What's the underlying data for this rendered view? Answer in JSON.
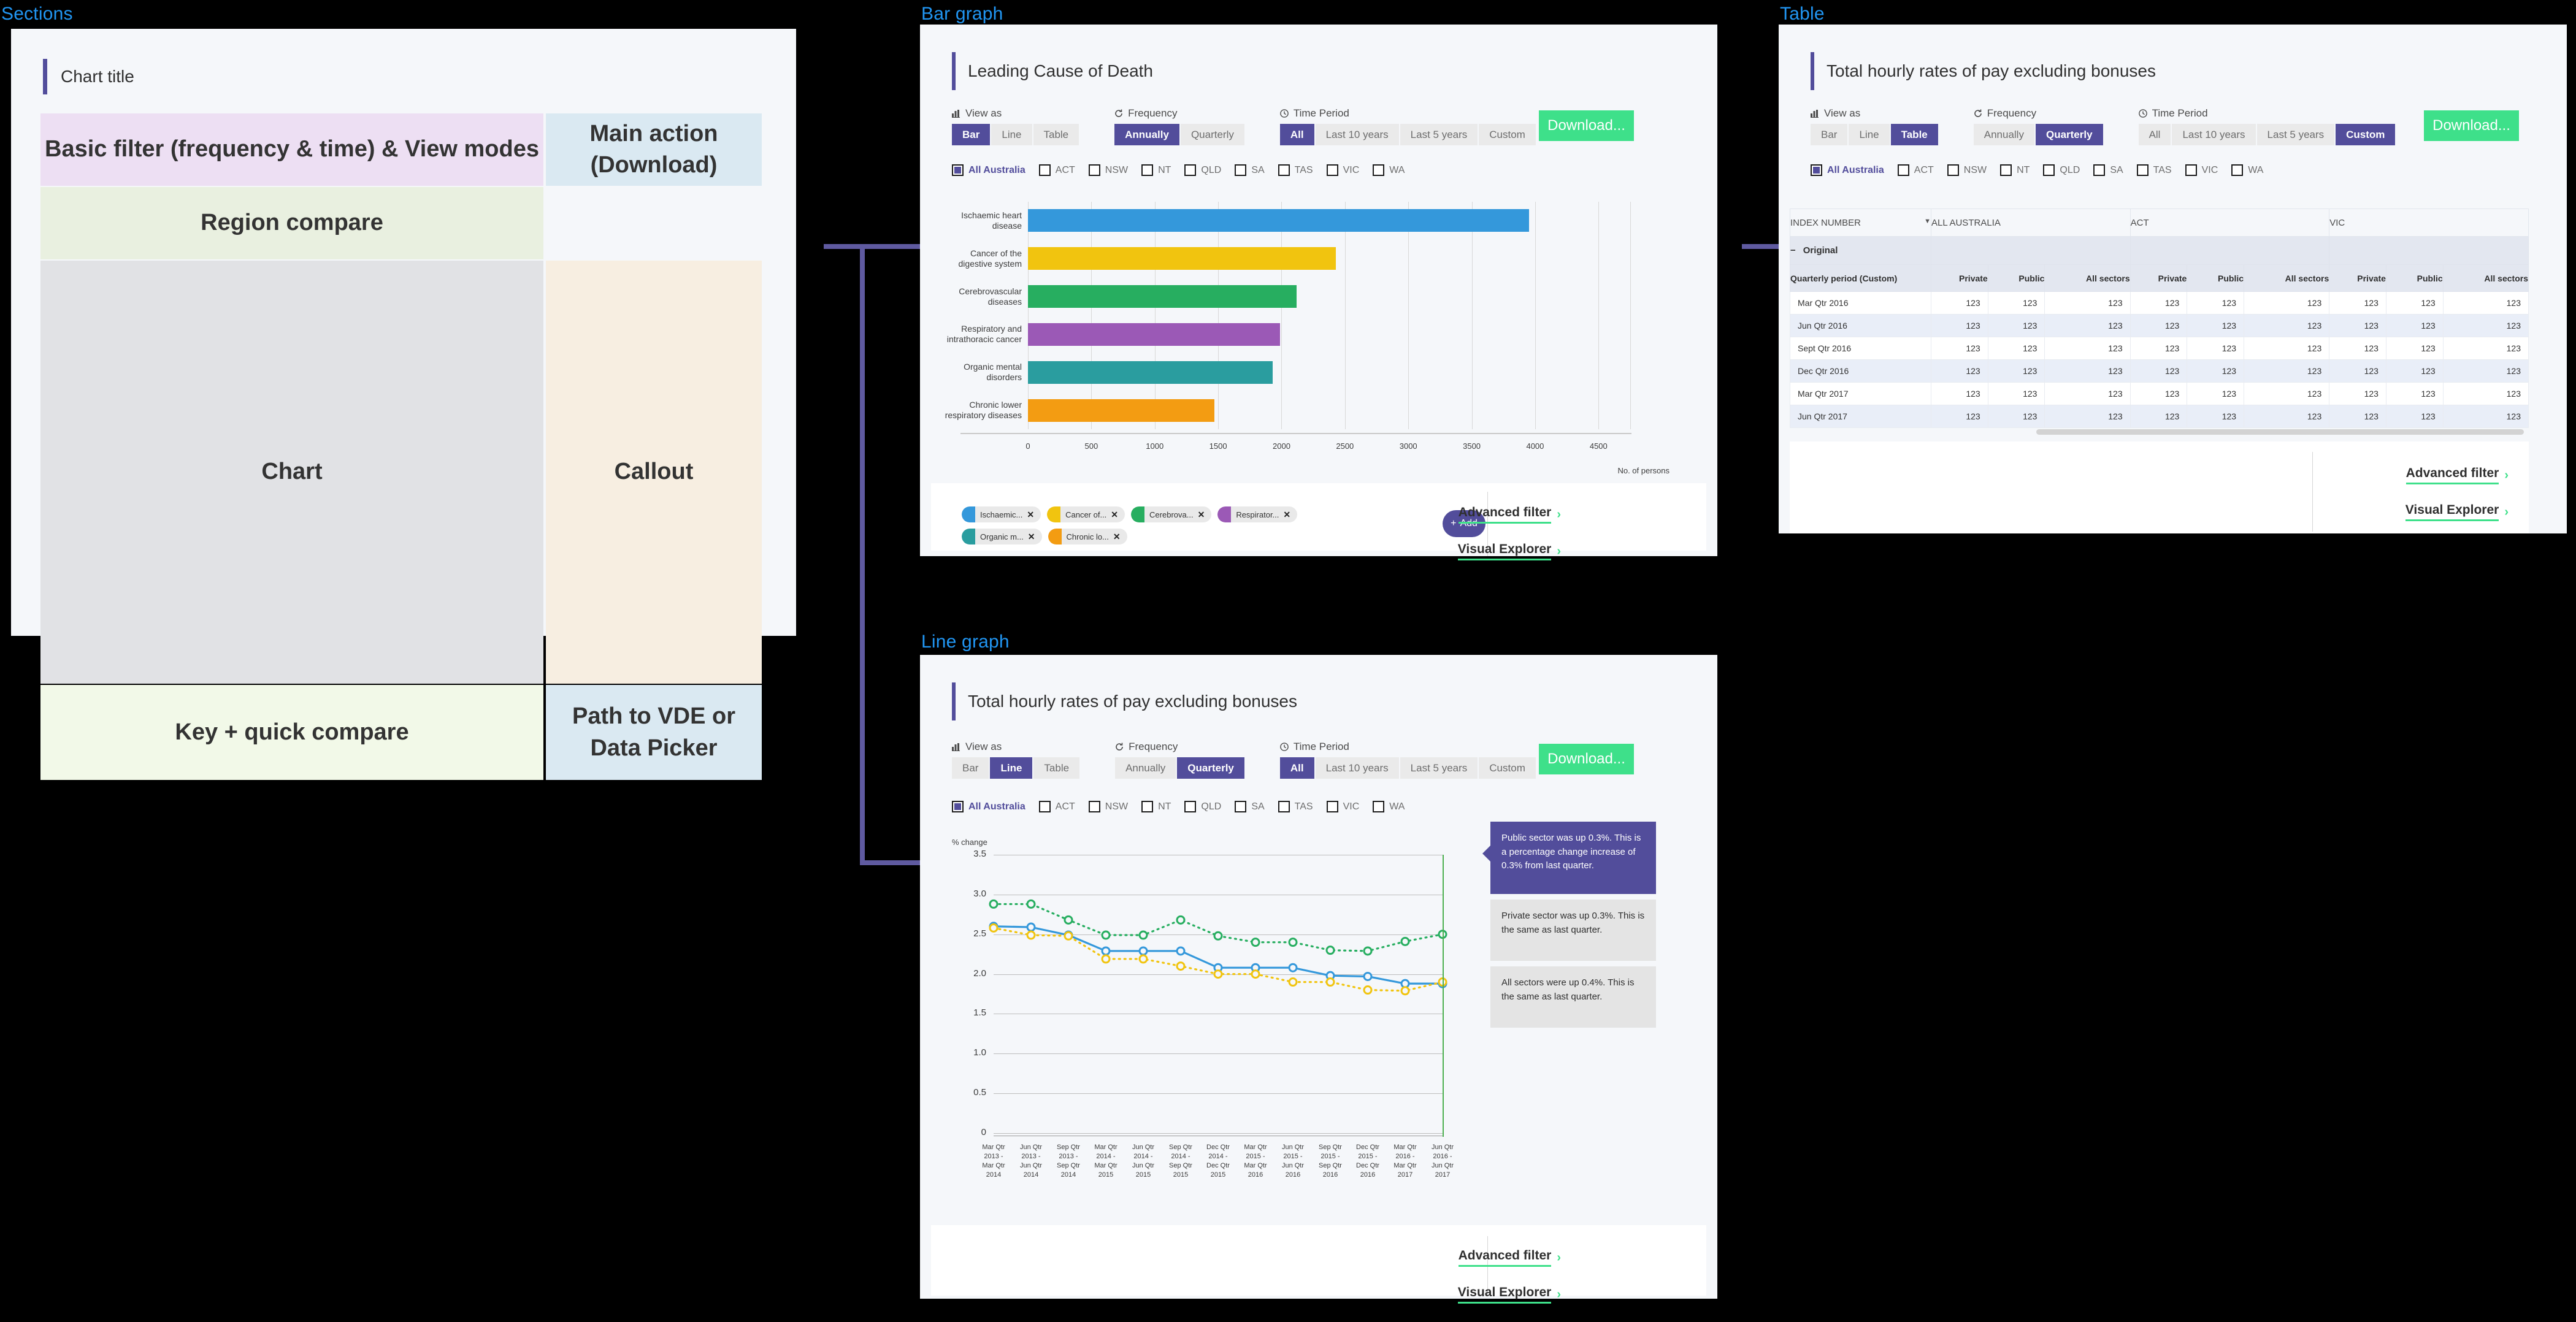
{
  "labels": {
    "sections": "Sections",
    "bar_graph": "Bar graph",
    "table": "Table",
    "line_graph": "Line graph"
  },
  "sections_wireframe": {
    "chart_title": "Chart title",
    "cells": [
      {
        "name": "basic-filter",
        "label": "Basic filter (frequency & time) & View modes",
        "color": "#eddff3"
      },
      {
        "name": "main-action",
        "label": "Main action\n(Download)",
        "color": "#dae9f2"
      },
      {
        "name": "region-compare",
        "label": "Region compare",
        "color": "#e9f0e0"
      },
      {
        "name": "chart",
        "label": "Chart",
        "color": "#e1e2e5"
      },
      {
        "name": "callout",
        "label": "Callout",
        "color": "#f7eee1"
      },
      {
        "name": "key-compare",
        "label": "Key + quick compare",
        "color": "#f2f9e8"
      },
      {
        "name": "path-vde",
        "label": "Path to VDE or\nData Picker",
        "color": "#dae9f2"
      }
    ],
    "cell_text": {
      "basic_filter": "Basic filter (frequency & time) & View modes",
      "main_action_l1": "Main action",
      "main_action_l2": "(Download)",
      "region_compare": "Region compare",
      "chart": "Chart",
      "callout": "Callout",
      "key_compare": "Key + quick compare",
      "path_l1": "Path to VDE or",
      "path_l2": "Data Picker"
    }
  },
  "common": {
    "view_as_label": "View as",
    "frequency_label": "Frequency",
    "time_period_label": "Time Period",
    "view_as_options": [
      "Bar",
      "Line",
      "Table"
    ],
    "frequency_options": [
      "Annually",
      "Quarterly"
    ],
    "time_period_options": [
      "All",
      "Last 10 years",
      "Last 5 years",
      "Custom"
    ],
    "download_label": "Download...",
    "regions": [
      "All Australia",
      "ACT",
      "NSW",
      "NT",
      "QLD",
      "SA",
      "TAS",
      "VIC",
      "WA"
    ],
    "selected_region": "All Australia",
    "advanced_filter": "Advanced filter",
    "visual_explorer": "Visual Explorer",
    "chevron": "›",
    "accent_purple": "#524d9b",
    "accent_green": "#3ee08a"
  },
  "bar_panel": {
    "title": "Leading Cause of Death",
    "view_as_selected": "Bar",
    "frequency_selected": "Annually",
    "time_period_selected": "All",
    "add_button": "Add",
    "add_icon": "+",
    "chips": [
      {
        "label": "Ischaemic...",
        "color": "#3498db"
      },
      {
        "label": "Cancer of...",
        "color": "#f1c40f"
      },
      {
        "label": "Cerebrova...",
        "color": "#27ae60"
      },
      {
        "label": "Respirator...",
        "color": "#9b59b6"
      },
      {
        "label": "Organic m...",
        "color": "#2a9d9f"
      },
      {
        "label": "Chronic lo...",
        "color": "#f39c12"
      }
    ]
  },
  "table_panel": {
    "title": "Total hourly rates of pay excluding bonuses",
    "view_as_selected": "Table",
    "frequency_selected": "Quarterly",
    "time_period_selected": "Custom",
    "index_header": "INDEX NUMBER",
    "group_row_label": "Original",
    "group_row_toggle": "−",
    "region_columns": [
      "ALL AUSTRALIA",
      "ACT",
      "VIC"
    ],
    "period_header": "Quarterly period (Custom)",
    "sector_columns": [
      "Private",
      "Public",
      "All sectors"
    ],
    "rows": [
      {
        "period": "Mar Qtr 2016",
        "values": [
          "123",
          "123",
          "123",
          "123",
          "123",
          "123",
          "123",
          "123",
          "123"
        ]
      },
      {
        "period": "Jun Qtr 2016",
        "values": [
          "123",
          "123",
          "123",
          "123",
          "123",
          "123",
          "123",
          "123",
          "123"
        ]
      },
      {
        "period": "Sept Qtr 2016",
        "values": [
          "123",
          "123",
          "123",
          "123",
          "123",
          "123",
          "123",
          "123",
          "123"
        ]
      },
      {
        "period": "Dec Qtr 2016",
        "values": [
          "123",
          "123",
          "123",
          "123",
          "123",
          "123",
          "123",
          "123",
          "123"
        ]
      },
      {
        "period": "Mar Qtr 2017",
        "values": [
          "123",
          "123",
          "123",
          "123",
          "123",
          "123",
          "123",
          "123",
          "123"
        ]
      },
      {
        "period": "Jun Qtr 2017",
        "values": [
          "123",
          "123",
          "123",
          "123",
          "123",
          "123",
          "123",
          "123",
          "123"
        ]
      }
    ]
  },
  "line_panel": {
    "title": "Total hourly rates of pay excluding bonuses",
    "view_as_selected": "Line",
    "frequency_selected": "Quarterly",
    "time_period_selected": "All",
    "callouts": [
      {
        "text": "Public sector was up 0.3%. This is a percentage change increase of 0.3% from last quarter.",
        "style": "primary"
      },
      {
        "text": "Private sector was up 0.3%. This is the same as last quarter.",
        "style": "muted"
      },
      {
        "text": "All sectors were up 0.4%. This is the same as last quarter.",
        "style": "muted"
      }
    ]
  },
  "chart_data": [
    {
      "id": "bar",
      "type": "bar",
      "orientation": "horizontal",
      "title": "Leading Cause of Death",
      "xlabel": "No. of persons",
      "ylabel": "",
      "xlim": [
        0,
        4750
      ],
      "xticks": [
        0,
        500,
        1000,
        1500,
        2000,
        2500,
        3000,
        3500,
        4000,
        4500
      ],
      "grid": true,
      "categories": [
        "Ischaemic heart disease",
        "Cancer of the digestive system",
        "Cerebrovascular diseases",
        "Respiratory and intrathoracic cancer",
        "Organic mental disorders",
        "Chronic lower respiratory diseases"
      ],
      "values": [
        3950,
        2430,
        2120,
        1990,
        1930,
        1470
      ],
      "colors": [
        "#3498db",
        "#f1c40f",
        "#27ae60",
        "#9b59b6",
        "#2a9d9f",
        "#f39c12"
      ]
    },
    {
      "id": "line",
      "type": "line",
      "title": "Total hourly rates of pay excluding bonuses",
      "ylabel": "% change",
      "xlabel": "",
      "ylim": [
        0,
        3.5
      ],
      "yticks": [
        0,
        0.5,
        1.0,
        1.5,
        2.0,
        2.5,
        3.0,
        3.5
      ],
      "ytick_labels": [
        "0",
        "0.5",
        "1.0",
        "1.5",
        "2.0",
        "2.5",
        "3.0",
        "3.5"
      ],
      "grid": true,
      "categories": [
        "Mar Qtr 2013 - Mar Qtr 2014",
        "Jun Qtr 2013 - Jun Qtr 2014",
        "Sep Qtr 2013 - Sep Qtr 2014",
        "Mar Qtr 2014 - Mar Qtr 2015",
        "Jun Qtr 2014 - Jun Qtr 2015",
        "Sep Qtr 2014 - Sep Qtr 2015",
        "Dec Qtr 2014 - Dec Qtr 2015",
        "Mar Qtr 2015 - Mar Qtr 2016",
        "Jun Qtr 2015 - Jun Qtr 2016",
        "Sep Qtr 2015 - Sep Qtr 2016",
        "Dec Qtr 2015 - Dec Qtr 2016",
        "Mar Qtr 2016 - Mar Qtr 2017",
        "Jun Qtr 2016 - Jun Qtr 2017"
      ],
      "xtick_lines": [
        [
          "Mar Qtr",
          "2013 -",
          "Mar Qtr",
          "2014"
        ],
        [
          "Jun Qtr",
          "2013 -",
          "Jun Qtr",
          "2014"
        ],
        [
          "Sep Qtr",
          "2013 -",
          "Sep Qtr",
          "2014"
        ],
        [
          "Mar Qtr",
          "2014 -",
          "Mar Qtr",
          "2015"
        ],
        [
          "Jun Qtr",
          "2014 -",
          "Jun Qtr",
          "2015"
        ],
        [
          "Sep Qtr",
          "2014 -",
          "Sep Qtr",
          "2015"
        ],
        [
          "Dec Qtr",
          "2014 -",
          "Dec Qtr",
          "2015"
        ],
        [
          "Mar Qtr",
          "2015 -",
          "Mar Qtr",
          "2016"
        ],
        [
          "Jun Qtr",
          "2015 -",
          "Jun Qtr",
          "2016"
        ],
        [
          "Sep Qtr",
          "2015 -",
          "Sep Qtr",
          "2016"
        ],
        [
          "Dec Qtr",
          "2015 -",
          "Dec Qtr",
          "2016"
        ],
        [
          "Mar Qtr",
          "2016 -",
          "Mar Qtr",
          "2017"
        ],
        [
          "Jun Qtr",
          "2016 -",
          "Jun Qtr",
          "2017"
        ]
      ],
      "series": [
        {
          "name": "Public sector",
          "color": "#27ae60",
          "dash": "dotted",
          "values": [
            2.88,
            2.88,
            2.68,
            2.49,
            2.49,
            2.68,
            2.48,
            2.4,
            2.4,
            2.3,
            2.29,
            2.41,
            2.5
          ]
        },
        {
          "name": "All sectors",
          "color": "#3498db",
          "dash": "solid",
          "values": [
            2.6,
            2.59,
            2.49,
            2.29,
            2.29,
            2.29,
            2.08,
            2.08,
            2.08,
            1.98,
            1.97,
            1.88,
            1.88
          ]
        },
        {
          "name": "Private sector",
          "color": "#f1c40f",
          "dash": "dotted",
          "values": [
            2.58,
            2.49,
            2.48,
            2.19,
            2.19,
            2.1,
            2.0,
            2.0,
            1.9,
            1.9,
            1.8,
            1.79,
            1.9
          ]
        }
      ],
      "marker_line_x_index": 12
    }
  ]
}
